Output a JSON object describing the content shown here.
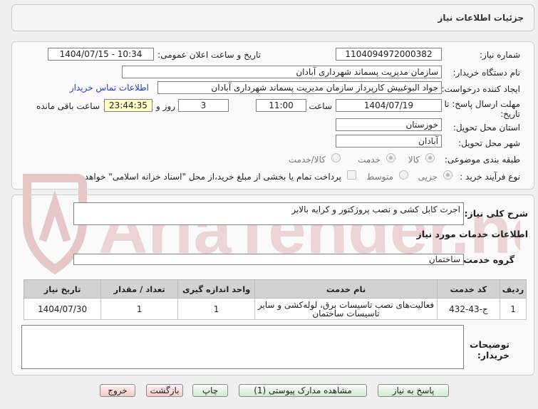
{
  "header": {
    "title": "جزئیات اطلاعات نیاز"
  },
  "fields": {
    "need_number_label": "شماره نیاز:",
    "need_number": "1104094972000382",
    "announce_label": "تاریخ و ساعت اعلان عمومی:",
    "announce_value": "1404/07/15 - 10:34",
    "buyer_org_label": "نام دستگاه خریدار:",
    "buyer_org": "سازمان مدیریت پسماند شهرداری آبادان",
    "creator_label": "ایجاد کننده درخواست:",
    "creator": "جواد البوغبیش کارپرداز سازمان مدیریت پسماند شهرداری آبادان",
    "contact_link": "اطلاعات تماس خریدار",
    "deadline_label_line1": "مهلت ارسال پاسخ: تا",
    "deadline_label_line2": "تاریخ:",
    "deadline_date": "1404/07/19",
    "time_label": "ساعت",
    "deadline_time": "11:00",
    "days_value": "3",
    "days_label": "روز و",
    "remaining_time": "23:44:35",
    "remaining_label": "ساعت باقی مانده",
    "province_label": "استان محل تحویل:",
    "province": "خوزستان",
    "city_label": "شهر محل تحویل:",
    "city": "آبادان",
    "category_label": "طبقه بندی موضوعی:",
    "category_options": [
      "کالا",
      "خدمت",
      "کالا/خدمت"
    ],
    "process_label": "نوع فرآیند خرید :",
    "process_options": [
      "جزیی",
      "متوسط"
    ],
    "payment_note": "پرداخت تمام یا بخشی از مبلغ خرید،از محل \"اسناد خزانه اسلامی\" خواهد بود."
  },
  "description": {
    "label": "شرح کلی نیاز:",
    "value": "اجرت کابل کشی و نصب پروژکتور و کرایه بالابر"
  },
  "services": {
    "section_title": "اطلاعات خدمات مورد نیاز",
    "group_label": "گروه خدمت:",
    "group_value": "ساختمان",
    "columns": [
      "ردیف",
      "کد خدمت",
      "نام خدمت",
      "واحد اندازه گیری",
      "تعداد / مقدار",
      "تاریخ نیاز"
    ],
    "rows": [
      {
        "row": "1",
        "code": "ج-43-432",
        "name_line1": "فعالیت‌های نصب تاسیسات برق، لوله‌کشی و سایر",
        "name_line2": "تاسیسات ساختمان",
        "unit": "1",
        "quantity": "1",
        "date": "1404/07/30"
      }
    ]
  },
  "notes": {
    "label_line1": "توضیحات",
    "label_line2": "خریدار:"
  },
  "buttons": {
    "reply": "پاسخ به نیاز",
    "documents": "مشاهده مدارک پیوستی (1)",
    "print": "چاپ",
    "back": "بازگشت",
    "exit": "خروج"
  },
  "watermark": {
    "text": "AriaTender.net"
  },
  "colors": {
    "link": "#1e3fc9",
    "remaining_bg": "#ffffc8",
    "watermark": "#e8c8c8"
  }
}
